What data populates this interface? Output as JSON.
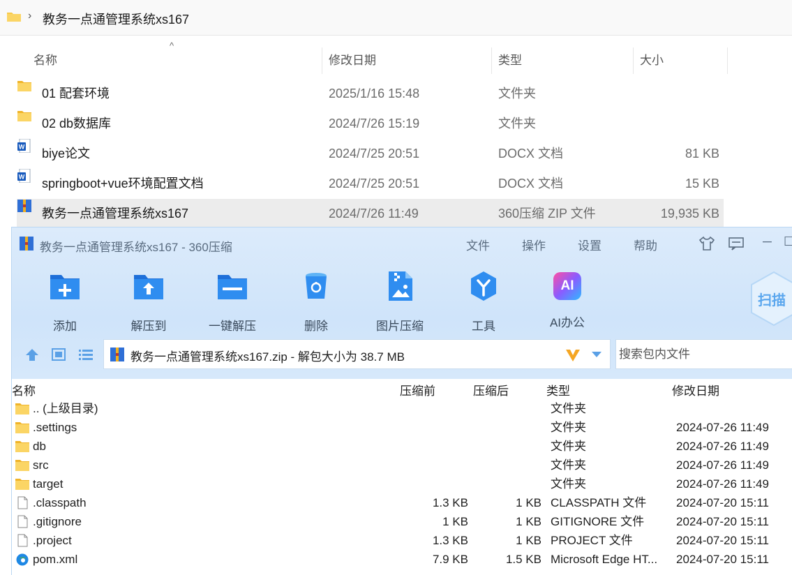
{
  "explorer": {
    "path": "教务一点通管理系统xs167",
    "columns": {
      "name": "名称",
      "date": "修改日期",
      "type": "类型",
      "size": "大小"
    },
    "rows": [
      {
        "name": "01 配套环境",
        "date": "2025/1/16 15:48",
        "type": "文件夹",
        "size": "",
        "icon": "folder-icon"
      },
      {
        "name": "02 db数据库",
        "date": "2024/7/26 15:19",
        "type": "文件夹",
        "size": "",
        "icon": "folder-icon"
      },
      {
        "name": "biye论文",
        "date": "2024/7/25 20:51",
        "type": "DOCX 文档",
        "size": "81 KB",
        "icon": "word-doc-icon"
      },
      {
        "name": "springboot+vue环境配置文档",
        "date": "2024/7/25 20:51",
        "type": "DOCX 文档",
        "size": "15 KB",
        "icon": "word-doc-icon"
      },
      {
        "name": "教务一点通管理系统xs167",
        "date": "2024/7/26 11:49",
        "type": "360压缩 ZIP 文件",
        "size": "19,935 KB",
        "icon": "zip-archive-icon",
        "selected": true
      }
    ]
  },
  "zip": {
    "title": "教务一点通管理系统xs167 - 360压缩",
    "menu": [
      "文件",
      "操作",
      "设置",
      "帮助"
    ],
    "toolbar": {
      "add": "添加",
      "extract_to": "解压到",
      "one_click": "一键解压",
      "delete": "删除",
      "image_compress": "图片压缩",
      "tools": "工具",
      "ai_office": "AI办公",
      "scan": "扫描",
      "ai_badge": "AI"
    },
    "path_text": "教务一点通管理系统xs167.zip - 解包大小为 38.7 MB",
    "search_placeholder": "搜索包内文件",
    "columns": {
      "name": "名称",
      "before": "压缩前",
      "after": "压缩后",
      "type": "类型",
      "date": "修改日期"
    },
    "rows": [
      {
        "name": ".. (上级目录)",
        "before": "",
        "after": "",
        "type": "文件夹",
        "date": "",
        "icon": "folder-icon"
      },
      {
        "name": ".settings",
        "before": "",
        "after": "",
        "type": "文件夹",
        "date": "2024-07-26 11:49",
        "icon": "folder-icon"
      },
      {
        "name": "db",
        "before": "",
        "after": "",
        "type": "文件夹",
        "date": "2024-07-26 11:49",
        "icon": "folder-icon"
      },
      {
        "name": "src",
        "before": "",
        "after": "",
        "type": "文件夹",
        "date": "2024-07-26 11:49",
        "icon": "folder-icon"
      },
      {
        "name": "target",
        "before": "",
        "after": "",
        "type": "文件夹",
        "date": "2024-07-26 11:49",
        "icon": "folder-icon"
      },
      {
        "name": ".classpath",
        "before": "1.3 KB",
        "after": "1 KB",
        "type": "CLASSPATH 文件",
        "date": "2024-07-20 15:11",
        "icon": "file-icon"
      },
      {
        "name": ".gitignore",
        "before": "1 KB",
        "after": "1 KB",
        "type": "GITIGNORE 文件",
        "date": "2024-07-20 15:11",
        "icon": "file-icon"
      },
      {
        "name": ".project",
        "before": "1.3 KB",
        "after": "1 KB",
        "type": "PROJECT 文件",
        "date": "2024-07-20 15:11",
        "icon": "file-icon"
      },
      {
        "name": "pom.xml",
        "before": "7.9 KB",
        "after": "1.5 KB",
        "type": "Microsoft Edge HT...",
        "date": "2024-07-20 15:11",
        "icon": "edge-icon"
      }
    ]
  },
  "colors": {
    "folder": "#f7c948",
    "accent": "#1e88e5",
    "selected_row": "#ececec",
    "zip_header": "#d6e8fb"
  }
}
